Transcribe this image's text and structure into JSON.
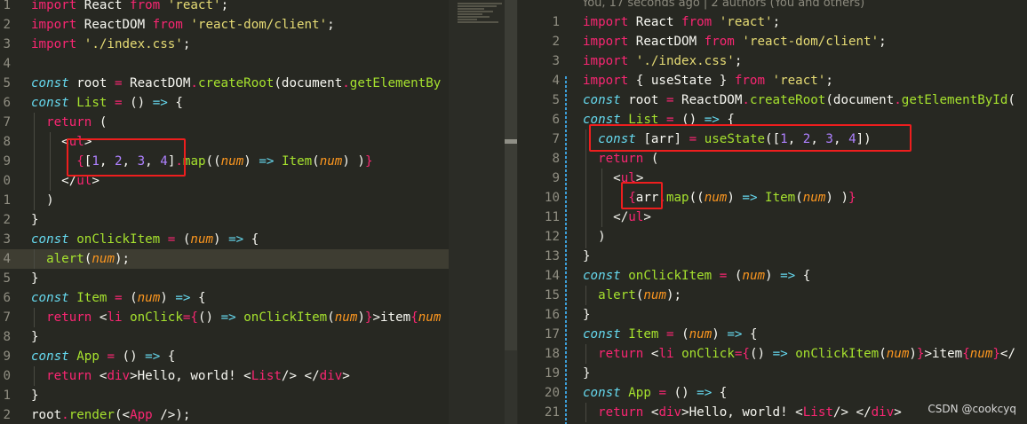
{
  "left_editor": {
    "lines": [
      {
        "n": "1",
        "tokens": [
          [
            "kw",
            "import"
          ],
          [
            "pl",
            " React "
          ],
          [
            "kw",
            "from"
          ],
          [
            "st",
            " 'react'"
          ],
          [
            "pl",
            ";"
          ]
        ]
      },
      {
        "n": "2",
        "tokens": [
          [
            "kw",
            "import"
          ],
          [
            "pl",
            " ReactDOM "
          ],
          [
            "kw",
            "from"
          ],
          [
            "st",
            " 'react-dom/client'"
          ],
          [
            "pl",
            ";"
          ]
        ]
      },
      {
        "n": "3",
        "tokens": [
          [
            "kw",
            "import"
          ],
          [
            "st",
            " './index.css'"
          ],
          [
            "pl",
            ";"
          ]
        ]
      },
      {
        "n": "4",
        "tokens": []
      },
      {
        "n": "5",
        "tokens": [
          [
            "cs",
            "const"
          ],
          [
            "pl",
            " root "
          ],
          [
            "kw",
            "="
          ],
          [
            "pl",
            " ReactDOM"
          ],
          [
            "kw",
            "."
          ],
          [
            "fn",
            "createRoot"
          ],
          [
            "pl",
            "(document"
          ],
          [
            "kw",
            "."
          ],
          [
            "fn",
            "getElementBy"
          ]
        ]
      },
      {
        "n": "6",
        "tokens": [
          [
            "cs",
            "const"
          ],
          [
            "pl",
            " "
          ],
          [
            "fn",
            "List"
          ],
          [
            "pl",
            " "
          ],
          [
            "kw",
            "="
          ],
          [
            "pl",
            " () "
          ],
          [
            "cs",
            "=>"
          ],
          [
            "pl",
            " {"
          ]
        ]
      },
      {
        "n": "7",
        "tokens": [
          [
            "pl",
            "  "
          ],
          [
            "kw",
            "return"
          ],
          [
            "pl",
            " ("
          ]
        ]
      },
      {
        "n": "8",
        "tokens": [
          [
            "pl",
            "    <"
          ],
          [
            "kw",
            "ul"
          ],
          [
            "pl",
            ">"
          ]
        ]
      },
      {
        "n": "9",
        "tokens": [
          [
            "pl",
            "      "
          ],
          [
            "kw",
            "{"
          ],
          [
            "pl",
            "["
          ],
          [
            "nu",
            "1"
          ],
          [
            "pl",
            ", "
          ],
          [
            "nu",
            "2"
          ],
          [
            "pl",
            ", "
          ],
          [
            "nu",
            "3"
          ],
          [
            "pl",
            ", "
          ],
          [
            "nu",
            "4"
          ],
          [
            "pl",
            "]"
          ],
          [
            "kw",
            "."
          ],
          [
            "fn",
            "map"
          ],
          [
            "pl",
            "(("
          ],
          [
            "pa",
            "num"
          ],
          [
            "pl",
            ") "
          ],
          [
            "cs",
            "=>"
          ],
          [
            "pl",
            " "
          ],
          [
            "fn",
            "Item"
          ],
          [
            "pl",
            "("
          ],
          [
            "pa",
            "num"
          ],
          [
            "pl",
            ") )"
          ],
          [
            "kw",
            "}"
          ]
        ]
      },
      {
        "n": "0",
        "tokens": [
          [
            "pl",
            "    </"
          ],
          [
            "kw",
            "ul"
          ],
          [
            "pl",
            ">"
          ]
        ]
      },
      {
        "n": "1",
        "tokens": [
          [
            "pl",
            "  )"
          ]
        ]
      },
      {
        "n": "2",
        "tokens": [
          [
            "pl",
            "}"
          ]
        ]
      },
      {
        "n": "3",
        "tokens": [
          [
            "cs",
            "const"
          ],
          [
            "pl",
            " "
          ],
          [
            "fn",
            "onClickItem"
          ],
          [
            "pl",
            " "
          ],
          [
            "kw",
            "="
          ],
          [
            "pl",
            " ("
          ],
          [
            "pa",
            "num"
          ],
          [
            "pl",
            ") "
          ],
          [
            "cs",
            "=>"
          ],
          [
            "pl",
            " {"
          ]
        ]
      },
      {
        "n": "4",
        "tokens": [
          [
            "pl",
            "  "
          ],
          [
            "fn",
            "alert"
          ],
          [
            "pl",
            "("
          ],
          [
            "pa",
            "num"
          ],
          [
            "pl",
            ");"
          ]
        ],
        "current": true
      },
      {
        "n": "5",
        "tokens": [
          [
            "pl",
            "}"
          ]
        ]
      },
      {
        "n": "6",
        "tokens": [
          [
            "cs",
            "const"
          ],
          [
            "pl",
            " "
          ],
          [
            "fn",
            "Item"
          ],
          [
            "pl",
            " "
          ],
          [
            "kw",
            "="
          ],
          [
            "pl",
            " ("
          ],
          [
            "pa",
            "num"
          ],
          [
            "pl",
            ") "
          ],
          [
            "cs",
            "=>"
          ],
          [
            "pl",
            " {"
          ]
        ]
      },
      {
        "n": "7",
        "tokens": [
          [
            "pl",
            "  "
          ],
          [
            "kw",
            "return"
          ],
          [
            "pl",
            " <"
          ],
          [
            "kw",
            "li"
          ],
          [
            "pl",
            " "
          ],
          [
            "fn",
            "onClick"
          ],
          [
            "kw",
            "={"
          ],
          [
            "pl",
            "() "
          ],
          [
            "cs",
            "=>"
          ],
          [
            "pl",
            " "
          ],
          [
            "fn",
            "onClickItem"
          ],
          [
            "pl",
            "("
          ],
          [
            "pa",
            "num"
          ],
          [
            "pl",
            ")"
          ],
          [
            "kw",
            "}"
          ],
          [
            "pl",
            ">item"
          ],
          [
            "kw",
            "{"
          ],
          [
            "pa",
            "num"
          ]
        ]
      },
      {
        "n": "8",
        "tokens": [
          [
            "pl",
            "}"
          ]
        ]
      },
      {
        "n": "9",
        "tokens": [
          [
            "cs",
            "const"
          ],
          [
            "pl",
            " "
          ],
          [
            "fn",
            "App"
          ],
          [
            "pl",
            " "
          ],
          [
            "kw",
            "="
          ],
          [
            "pl",
            " () "
          ],
          [
            "cs",
            "=>"
          ],
          [
            "pl",
            " {"
          ]
        ]
      },
      {
        "n": "0",
        "tokens": [
          [
            "pl",
            "  "
          ],
          [
            "kw",
            "return"
          ],
          [
            "pl",
            " <"
          ],
          [
            "kw",
            "div"
          ],
          [
            "pl",
            ">Hello, world! <"
          ],
          [
            "kw",
            "List"
          ],
          [
            "pl",
            "/> </"
          ],
          [
            "kw",
            "div"
          ],
          [
            "pl",
            ">"
          ]
        ]
      },
      {
        "n": "1",
        "tokens": [
          [
            "pl",
            "}"
          ]
        ]
      },
      {
        "n": "2",
        "tokens": [
          [
            "pl",
            "root"
          ],
          [
            "kw",
            "."
          ],
          [
            "fn",
            "render"
          ],
          [
            "pl",
            "(<"
          ],
          [
            "kw",
            "App"
          ],
          [
            "pl",
            " />);"
          ]
        ]
      }
    ]
  },
  "right_editor": {
    "blame": "You, 17 seconds ago | 2 authors (You and others)",
    "lines": [
      {
        "n": "1",
        "tokens": [
          [
            "kw",
            "import"
          ],
          [
            "pl",
            " React "
          ],
          [
            "kw",
            "from"
          ],
          [
            "st",
            " 'react'"
          ],
          [
            "pl",
            ";"
          ]
        ]
      },
      {
        "n": "2",
        "tokens": [
          [
            "kw",
            "import"
          ],
          [
            "pl",
            " ReactDOM "
          ],
          [
            "kw",
            "from"
          ],
          [
            "st",
            " 'react-dom/client'"
          ],
          [
            "pl",
            ";"
          ]
        ]
      },
      {
        "n": "3",
        "tokens": [
          [
            "kw",
            "import"
          ],
          [
            "st",
            " './index.css'"
          ],
          [
            "pl",
            ";"
          ]
        ]
      },
      {
        "n": "4",
        "tokens": [
          [
            "kw",
            "import"
          ],
          [
            "pl",
            " { useState } "
          ],
          [
            "kw",
            "from"
          ],
          [
            "st",
            " 'react'"
          ],
          [
            "pl",
            ";"
          ]
        ]
      },
      {
        "n": "5",
        "tokens": [
          [
            "cs",
            "const"
          ],
          [
            "pl",
            " root "
          ],
          [
            "kw",
            "="
          ],
          [
            "pl",
            " ReactDOM"
          ],
          [
            "kw",
            "."
          ],
          [
            "fn",
            "createRoot"
          ],
          [
            "pl",
            "(document"
          ],
          [
            "kw",
            "."
          ],
          [
            "fn",
            "getElementById"
          ],
          [
            "pl",
            "("
          ]
        ]
      },
      {
        "n": "6",
        "tokens": [
          [
            "cs",
            "const"
          ],
          [
            "pl",
            " "
          ],
          [
            "fn",
            "List"
          ],
          [
            "pl",
            " "
          ],
          [
            "kw",
            "="
          ],
          [
            "pl",
            " () "
          ],
          [
            "cs",
            "=>"
          ],
          [
            "pl",
            " {"
          ]
        ]
      },
      {
        "n": "7",
        "tokens": [
          [
            "pl",
            "  "
          ],
          [
            "cs",
            "const"
          ],
          [
            "pl",
            " [arr] "
          ],
          [
            "kw",
            "="
          ],
          [
            "pl",
            " "
          ],
          [
            "fn",
            "useState"
          ],
          [
            "pl",
            "(["
          ],
          [
            "nu",
            "1"
          ],
          [
            "pl",
            ", "
          ],
          [
            "nu",
            "2"
          ],
          [
            "pl",
            ", "
          ],
          [
            "nu",
            "3"
          ],
          [
            "pl",
            ", "
          ],
          [
            "nu",
            "4"
          ],
          [
            "pl",
            "])"
          ]
        ]
      },
      {
        "n": "8",
        "tokens": [
          [
            "pl",
            "  "
          ],
          [
            "kw",
            "return"
          ],
          [
            "pl",
            " ("
          ]
        ]
      },
      {
        "n": "9",
        "tokens": [
          [
            "pl",
            "    <"
          ],
          [
            "kw",
            "ul"
          ],
          [
            "pl",
            ">"
          ]
        ]
      },
      {
        "n": "10",
        "tokens": [
          [
            "pl",
            "      "
          ],
          [
            "kw",
            "{"
          ],
          [
            "pl",
            "arr"
          ],
          [
            "kw",
            "."
          ],
          [
            "fn",
            "map"
          ],
          [
            "pl",
            "(("
          ],
          [
            "pa",
            "num"
          ],
          [
            "pl",
            ") "
          ],
          [
            "cs",
            "=>"
          ],
          [
            "pl",
            " "
          ],
          [
            "fn",
            "Item"
          ],
          [
            "pl",
            "("
          ],
          [
            "pa",
            "num"
          ],
          [
            "pl",
            ") )"
          ],
          [
            "kw",
            "}"
          ]
        ]
      },
      {
        "n": "11",
        "tokens": [
          [
            "pl",
            "    </"
          ],
          [
            "kw",
            "ul"
          ],
          [
            "pl",
            ">"
          ]
        ]
      },
      {
        "n": "12",
        "tokens": [
          [
            "pl",
            "  )"
          ]
        ]
      },
      {
        "n": "13",
        "tokens": [
          [
            "pl",
            "}"
          ]
        ]
      },
      {
        "n": "14",
        "tokens": [
          [
            "cs",
            "const"
          ],
          [
            "pl",
            " "
          ],
          [
            "fn",
            "onClickItem"
          ],
          [
            "pl",
            " "
          ],
          [
            "kw",
            "="
          ],
          [
            "pl",
            " ("
          ],
          [
            "pa",
            "num"
          ],
          [
            "pl",
            ") "
          ],
          [
            "cs",
            "=>"
          ],
          [
            "pl",
            " {"
          ]
        ]
      },
      {
        "n": "15",
        "tokens": [
          [
            "pl",
            "  "
          ],
          [
            "fn",
            "alert"
          ],
          [
            "pl",
            "("
          ],
          [
            "pa",
            "num"
          ],
          [
            "pl",
            ");"
          ]
        ]
      },
      {
        "n": "16",
        "tokens": [
          [
            "pl",
            "}"
          ]
        ]
      },
      {
        "n": "17",
        "tokens": [
          [
            "cs",
            "const"
          ],
          [
            "pl",
            " "
          ],
          [
            "fn",
            "Item"
          ],
          [
            "pl",
            " "
          ],
          [
            "kw",
            "="
          ],
          [
            "pl",
            " ("
          ],
          [
            "pa",
            "num"
          ],
          [
            "pl",
            ") "
          ],
          [
            "cs",
            "=>"
          ],
          [
            "pl",
            " {"
          ]
        ]
      },
      {
        "n": "18",
        "tokens": [
          [
            "pl",
            "  "
          ],
          [
            "kw",
            "return"
          ],
          [
            "pl",
            " <"
          ],
          [
            "kw",
            "li"
          ],
          [
            "pl",
            " "
          ],
          [
            "fn",
            "onClick"
          ],
          [
            "kw",
            "={"
          ],
          [
            "pl",
            "() "
          ],
          [
            "cs",
            "=>"
          ],
          [
            "pl",
            " "
          ],
          [
            "fn",
            "onClickItem"
          ],
          [
            "pl",
            "("
          ],
          [
            "pa",
            "num"
          ],
          [
            "pl",
            ")"
          ],
          [
            "kw",
            "}"
          ],
          [
            "pl",
            ">item"
          ],
          [
            "kw",
            "{"
          ],
          [
            "pa",
            "num"
          ],
          [
            "kw",
            "}"
          ],
          [
            "pl",
            "</"
          ]
        ]
      },
      {
        "n": "19",
        "tokens": [
          [
            "pl",
            "}"
          ]
        ]
      },
      {
        "n": "20",
        "tokens": [
          [
            "cs",
            "const"
          ],
          [
            "pl",
            " "
          ],
          [
            "fn",
            "App"
          ],
          [
            "pl",
            " "
          ],
          [
            "kw",
            "="
          ],
          [
            "pl",
            " () "
          ],
          [
            "cs",
            "=>"
          ],
          [
            "pl",
            " {"
          ]
        ]
      },
      {
        "n": "21",
        "tokens": [
          [
            "pl",
            "  "
          ],
          [
            "kw",
            "return"
          ],
          [
            "pl",
            " <"
          ],
          [
            "kw",
            "div"
          ],
          [
            "pl",
            ">Hello, world! <"
          ],
          [
            "kw",
            "List"
          ],
          [
            "pl",
            "/> </"
          ],
          [
            "kw",
            "div"
          ],
          [
            "pl",
            ">"
          ]
        ]
      }
    ]
  },
  "watermark": "CSDN @cookcyq",
  "colors": {
    "background": "#272822",
    "highlight_box": "#ee1e1e",
    "git_change_bar": "#3c9fd9"
  }
}
